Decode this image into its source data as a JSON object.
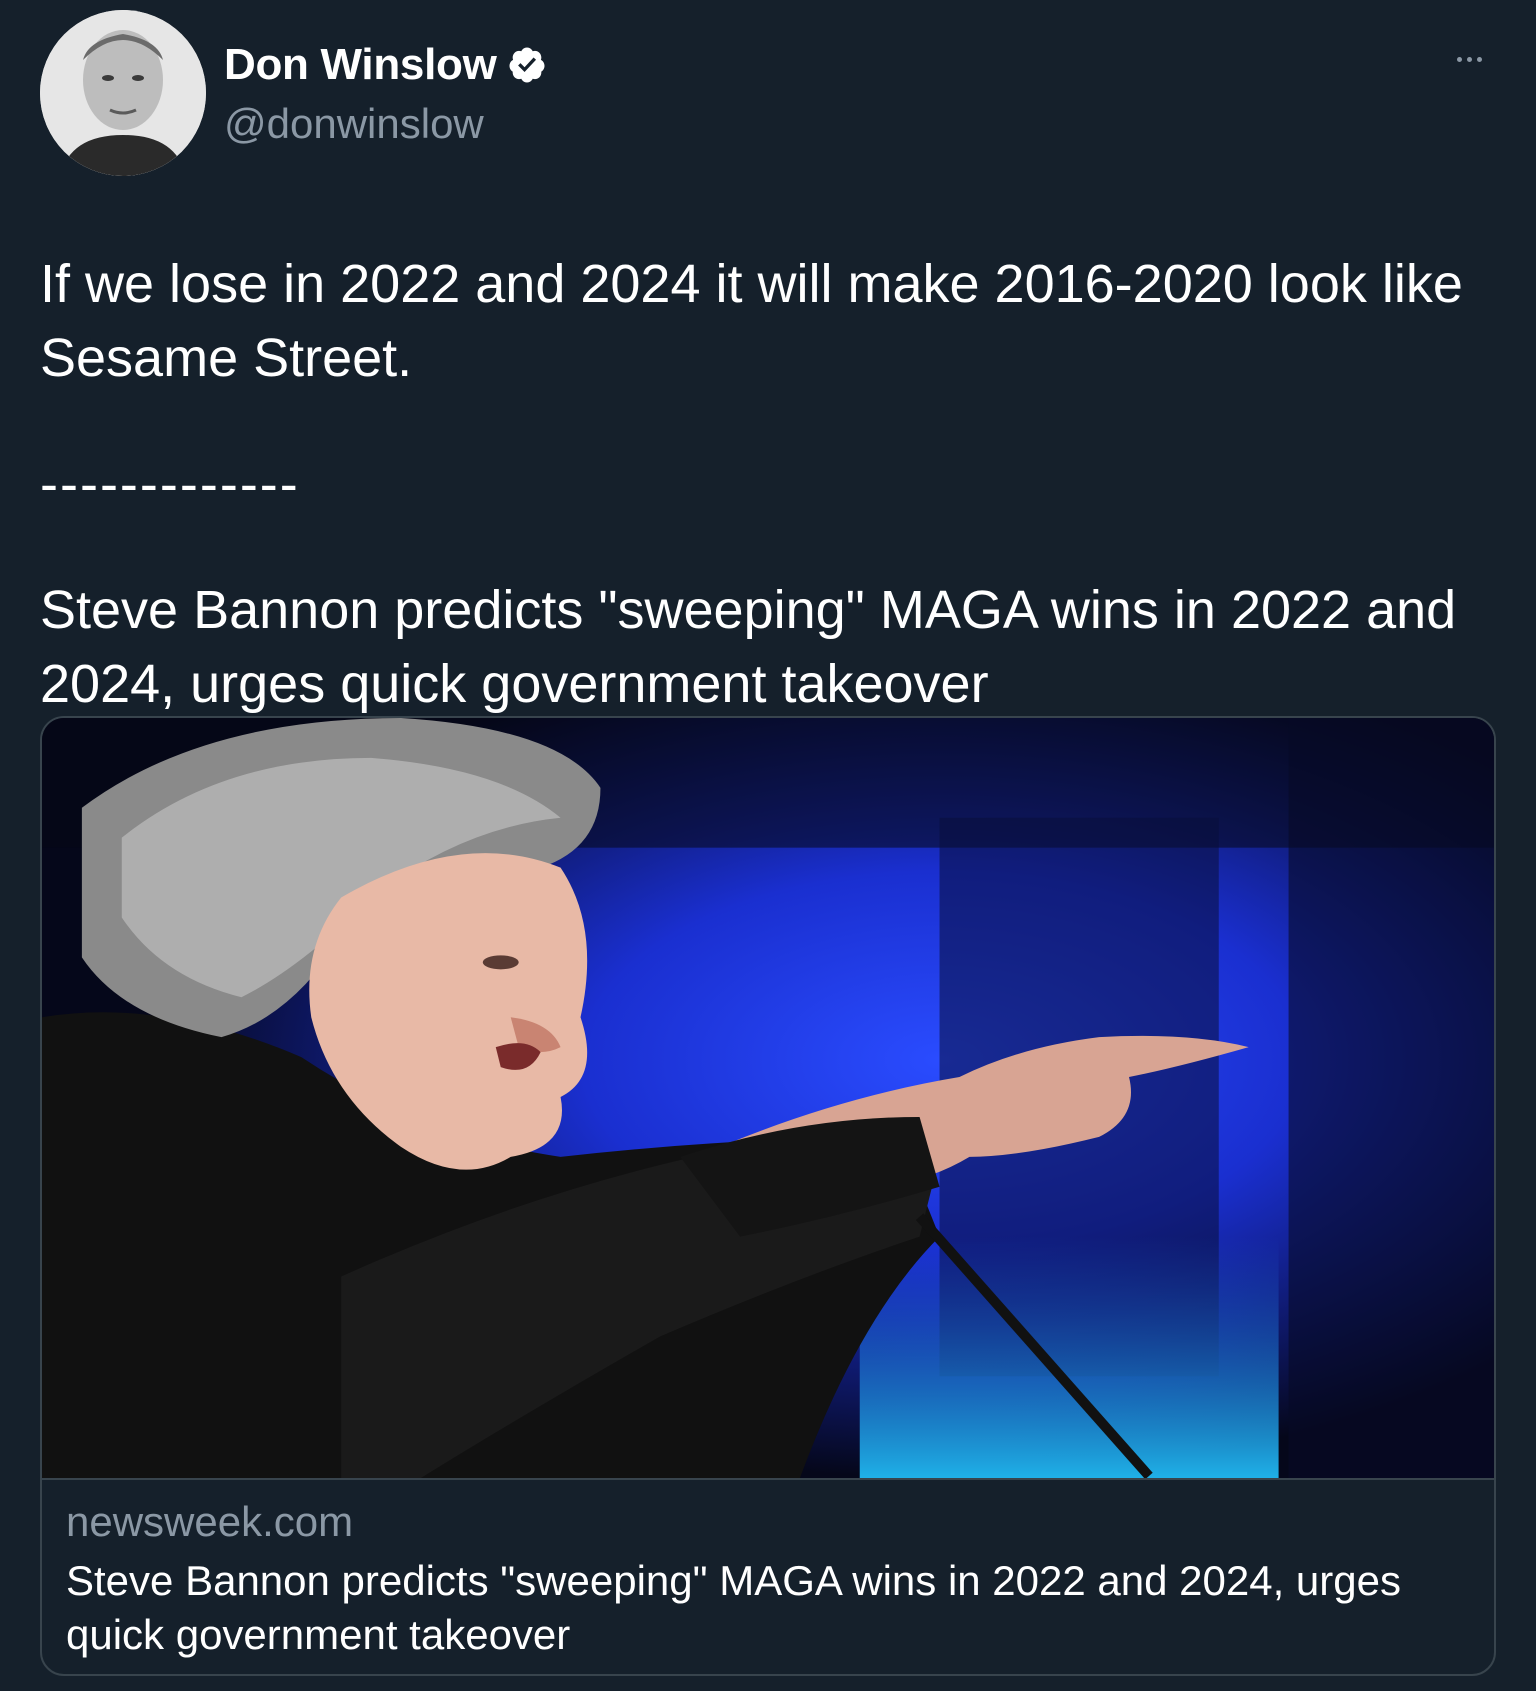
{
  "author": {
    "display_name": "Don Winslow",
    "handle": "@donwinslow",
    "verified": true
  },
  "tweet": {
    "line1": "If we lose in 2022 and 2024 it will make 2016-2020 look like Sesame Street.",
    "separator": "-------------",
    "quote": "Steve Bannon predicts \"sweeping\" MAGA wins in 2022 and 2024, urges quick government takeover"
  },
  "card": {
    "domain": "newsweek.com",
    "title": "Steve Bannon predicts \"sweeping\" MAGA wins in 2022 and 2024, urges quick government takeover"
  },
  "icons": {
    "verified": "verified-badge-icon",
    "more": "more-options-icon"
  },
  "colors": {
    "background": "#15202b",
    "secondary_text": "#8b98a5",
    "border": "#38444d"
  }
}
